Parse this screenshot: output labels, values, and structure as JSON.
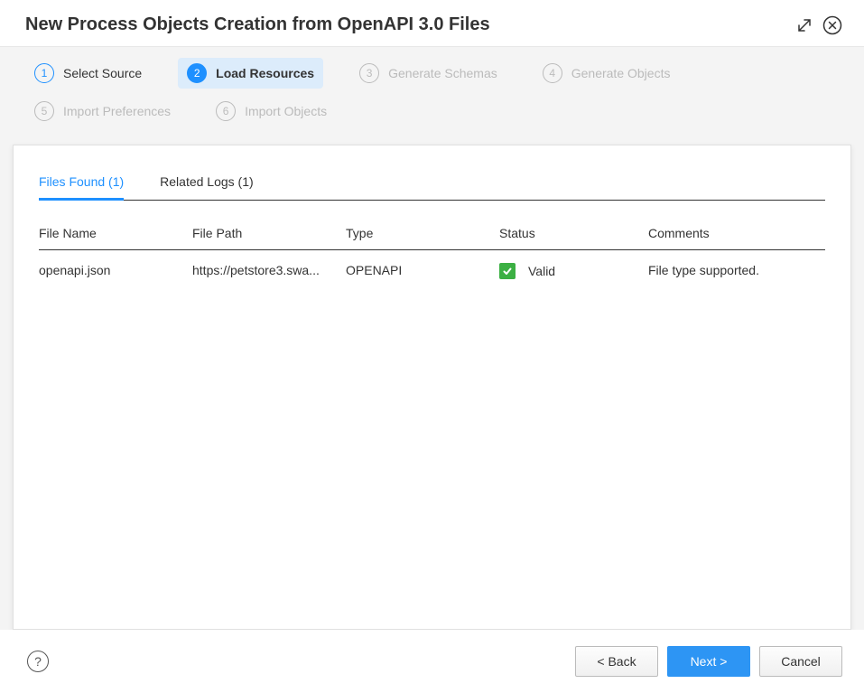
{
  "title": "New Process Objects Creation from OpenAPI 3.0 Files",
  "steps": [
    {
      "num": "1",
      "label": "Select Source",
      "state": "done"
    },
    {
      "num": "2",
      "label": "Load Resources",
      "state": "active"
    },
    {
      "num": "3",
      "label": "Generate Schemas",
      "state": ""
    },
    {
      "num": "4",
      "label": "Generate Objects",
      "state": ""
    },
    {
      "num": "5",
      "label": "Import Preferences",
      "state": ""
    },
    {
      "num": "6",
      "label": "Import Objects",
      "state": ""
    }
  ],
  "tabs": {
    "files": "Files Found (1)",
    "logs": "Related Logs (1)"
  },
  "columns": {
    "name": "File Name",
    "path": "File Path",
    "type": "Type",
    "status": "Status",
    "comments": "Comments"
  },
  "rows": [
    {
      "name": "openapi.json",
      "path": "https://petstore3.swa...",
      "type": "OPENAPI",
      "status": "Valid",
      "comments": "File type supported."
    }
  ],
  "buttons": {
    "back": "< Back",
    "next": "Next >",
    "cancel": "Cancel"
  },
  "help": "?"
}
